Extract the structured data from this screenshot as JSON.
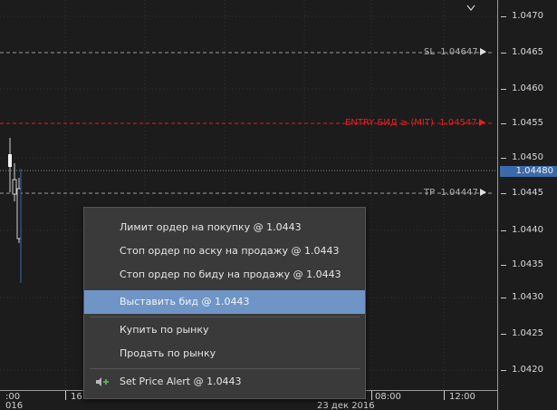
{
  "price_axis": {
    "ticks": [
      "1.0470",
      "1.0465",
      "1.0460",
      "1.0455",
      "1.0450",
      "1.0445",
      "1.0440",
      "1.0435",
      "1.0430",
      "1.0425",
      "1.0420"
    ],
    "current_price": "1.04480"
  },
  "lines": {
    "sl": {
      "label": "SL",
      "price": "1.04647",
      "color": "#aaaaaa"
    },
    "entry": {
      "label": "ENTRY БИД ≥ (MIT)",
      "price": "1.04547",
      "color": "#e02020"
    },
    "tp": {
      "label": "TP",
      "price": "1.04447",
      "color": "#aaaaaa"
    }
  },
  "time_axis": {
    "labels": [
      ":00",
      "16",
      "08:00",
      "12:00"
    ],
    "date_labels": [
      "016",
      "23 дек 2016"
    ]
  },
  "context_menu": {
    "items": [
      {
        "label": "Лимит ордер на покупку @ 1.0443"
      },
      {
        "label": "Стоп ордер по аску на продажу @ 1.0443"
      },
      {
        "label": "Стоп ордер по биду на продажу @ 1.0443"
      },
      {
        "label": "Выставить бид @ 1.0443",
        "selected": true
      },
      {
        "label": "Купить по рынку"
      },
      {
        "label": "Продать по рынку"
      },
      {
        "label": "Set Price Alert @ 1.0443"
      }
    ]
  },
  "colors": {
    "background": "#1c1c1c",
    "grid": "#3a3a3a",
    "entry_line": "#e02020",
    "current_price_tag": "#3c6aa8",
    "menu_highlight": "#6f95c6",
    "alert_icon_green": "#4caf50"
  }
}
